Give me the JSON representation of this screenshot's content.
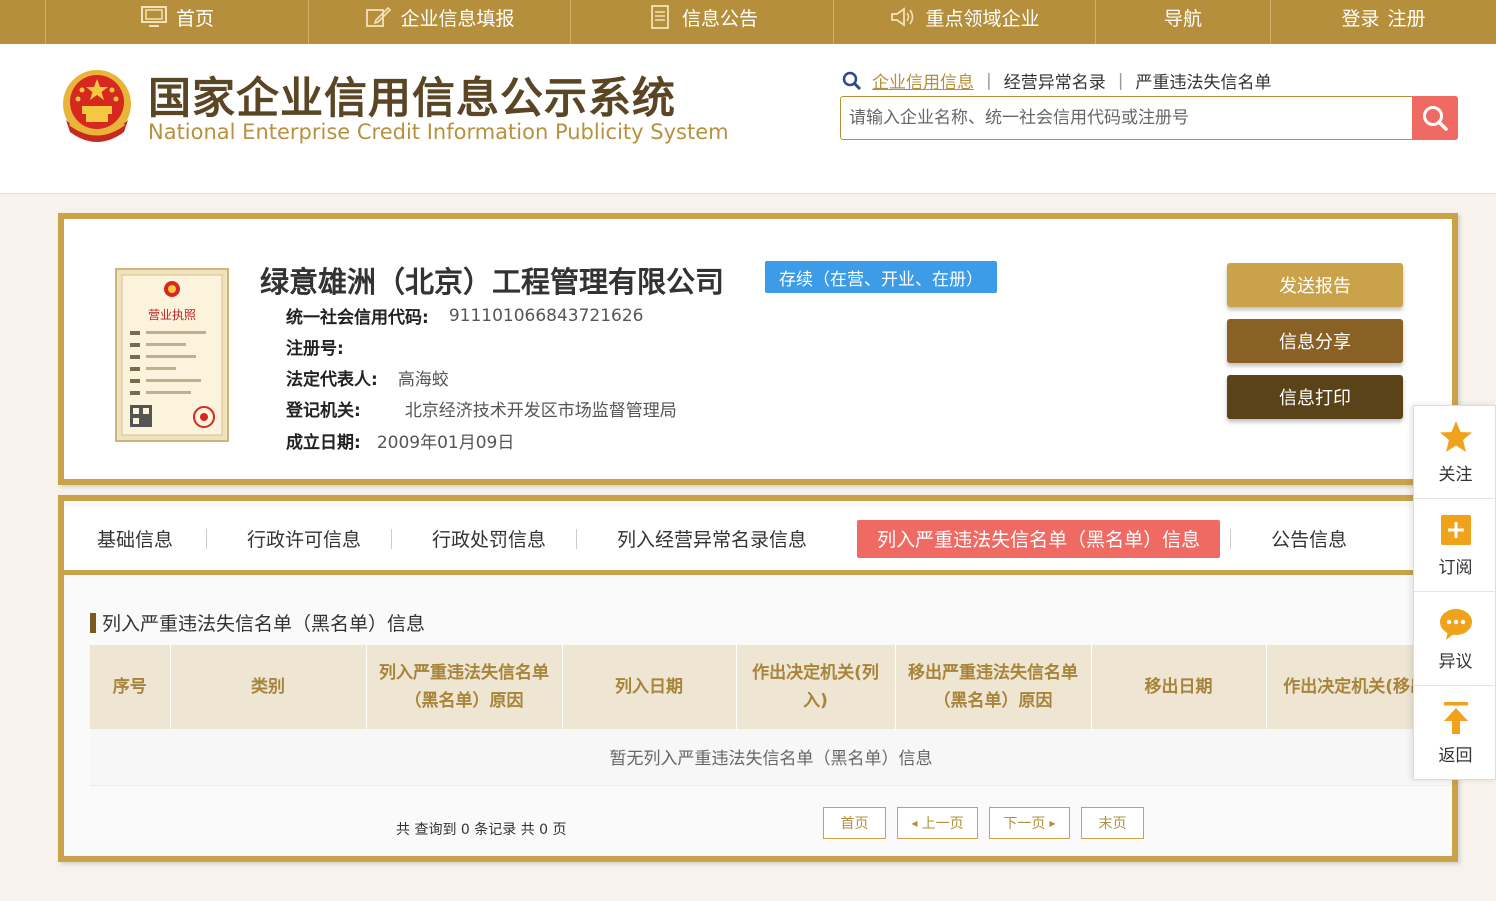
{
  "topnav": {
    "home": "首页",
    "fill_report": "企业信息填报",
    "announcement": "信息公告",
    "key_field": "重点领域企业",
    "navigation": "导航",
    "login": "登录",
    "register": "注册"
  },
  "header": {
    "title_cn": "国家企业信用信息公示系统",
    "title_en": "National Enterprise Credit Information Publicity System",
    "search_tabs": [
      "企业信用信息",
      "经营异常名录",
      "严重违法失信名单"
    ],
    "search_placeholder": "请输入企业名称、统一社会信用代码或注册号"
  },
  "company": {
    "name": "绿意雄洲（北京）工程管理有限公司",
    "status": "存续（在营、开业、在册）",
    "credit_code_label": "统一社会信用代码:",
    "credit_code": "911101066843721626",
    "reg_no_label": "注册号:",
    "reg_no": "",
    "legal_rep_label": "法定代表人:",
    "legal_rep": "高海蛟",
    "reg_authority_label": "登记机关:",
    "reg_authority": "北京经济技术开发区市场监督管理局",
    "established_label": "成立日期:",
    "established": "2009年01月09日",
    "license_text": "营业执照"
  },
  "actions": {
    "send_report": "发送报告",
    "share": "信息分享",
    "print": "信息打印"
  },
  "tabs": [
    "基础信息",
    "行政许可信息",
    "行政处罚信息",
    "列入经营异常名录信息",
    "列入严重违法失信名单（黑名单）信息",
    "公告信息"
  ],
  "section": {
    "title": "列入严重违法失信名单（黑名单）信息",
    "columns": [
      "序号",
      "类别",
      "列入严重违法失信名单（黑名单）原因",
      "列入日期",
      "作出决定机关(列入)",
      "移出严重违法失信名单（黑名单）原因",
      "移出日期",
      "作出决定机关(移出)"
    ],
    "empty_text": "暂无列入严重违法失信名单（黑名单）信息"
  },
  "pagination": {
    "summary": "共 查询到 0 条记录 共 0 页",
    "first": "首页",
    "prev": "上一页",
    "next": "下一页",
    "last": "末页"
  },
  "floatbar": {
    "follow": "关注",
    "subscribe": "订阅",
    "objection": "异议",
    "back": "返回"
  },
  "colors": {
    "gold": "#b58f3b",
    "border_gold": "#c9a24a",
    "coral": "#f06a64",
    "status_blue": "#3c9ce8",
    "btn_light": "#c9a24a",
    "btn_mid": "#8a6125",
    "btn_dark": "#5b4319"
  }
}
